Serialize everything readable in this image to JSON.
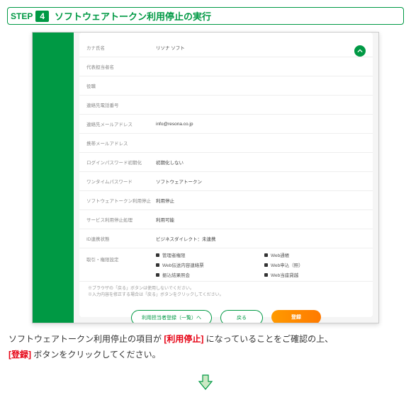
{
  "step": {
    "label": "STEP",
    "number": "4",
    "title": "ソフトウェアトークン利用停止の実行"
  },
  "form": {
    "rows": [
      {
        "label": "カナ氏名",
        "value": "リソナ ソフト"
      },
      {
        "label": "代表担当者名",
        "value": ""
      },
      {
        "label": "役職",
        "value": ""
      },
      {
        "label": "連絡先電話番号",
        "value": ""
      },
      {
        "label": "連絡先メールアドレス",
        "value": "info@resona.co.jp"
      },
      {
        "label": "携帯メールアドレス",
        "value": ""
      },
      {
        "label": "ログインパスワード初期化",
        "value": "初期化しない"
      },
      {
        "label": "ワンタイムパスワード",
        "value": "ソフトウェアトークン"
      },
      {
        "label": "ソフトウェアトークン利用停止",
        "value": "利用停止"
      },
      {
        "label": "サービス利用停止処理",
        "value": "利用可能"
      },
      {
        "label": "ID連携状態",
        "value": "ビジネスダイレクト：未連携"
      }
    ],
    "permissions": {
      "label": "取引・権限設定",
      "items": [
        "管理者権限",
        "Web通帳",
        "Web伝送内容連絡票",
        "Web申込（照）",
        "振込結果照会",
        "Web当座貸越"
      ]
    },
    "notes": [
      "※ブラウザの「戻る」ボタンは使用しないでください。",
      "※入力内容を修正する場合は「戻る」ボタンをクリックしてください。"
    ],
    "buttons": {
      "list": "利用担当者登録（一覧）へ",
      "back": "戻る",
      "register": "登録"
    }
  },
  "instruction": {
    "part1": "ソフトウェアトークン利用停止の項目が ",
    "highlight1": "[利用停止]",
    "part2": " になっていることをご確認の上、",
    "highlight2": "[登録]",
    "part3": " ボタンをクリックしてください。"
  }
}
